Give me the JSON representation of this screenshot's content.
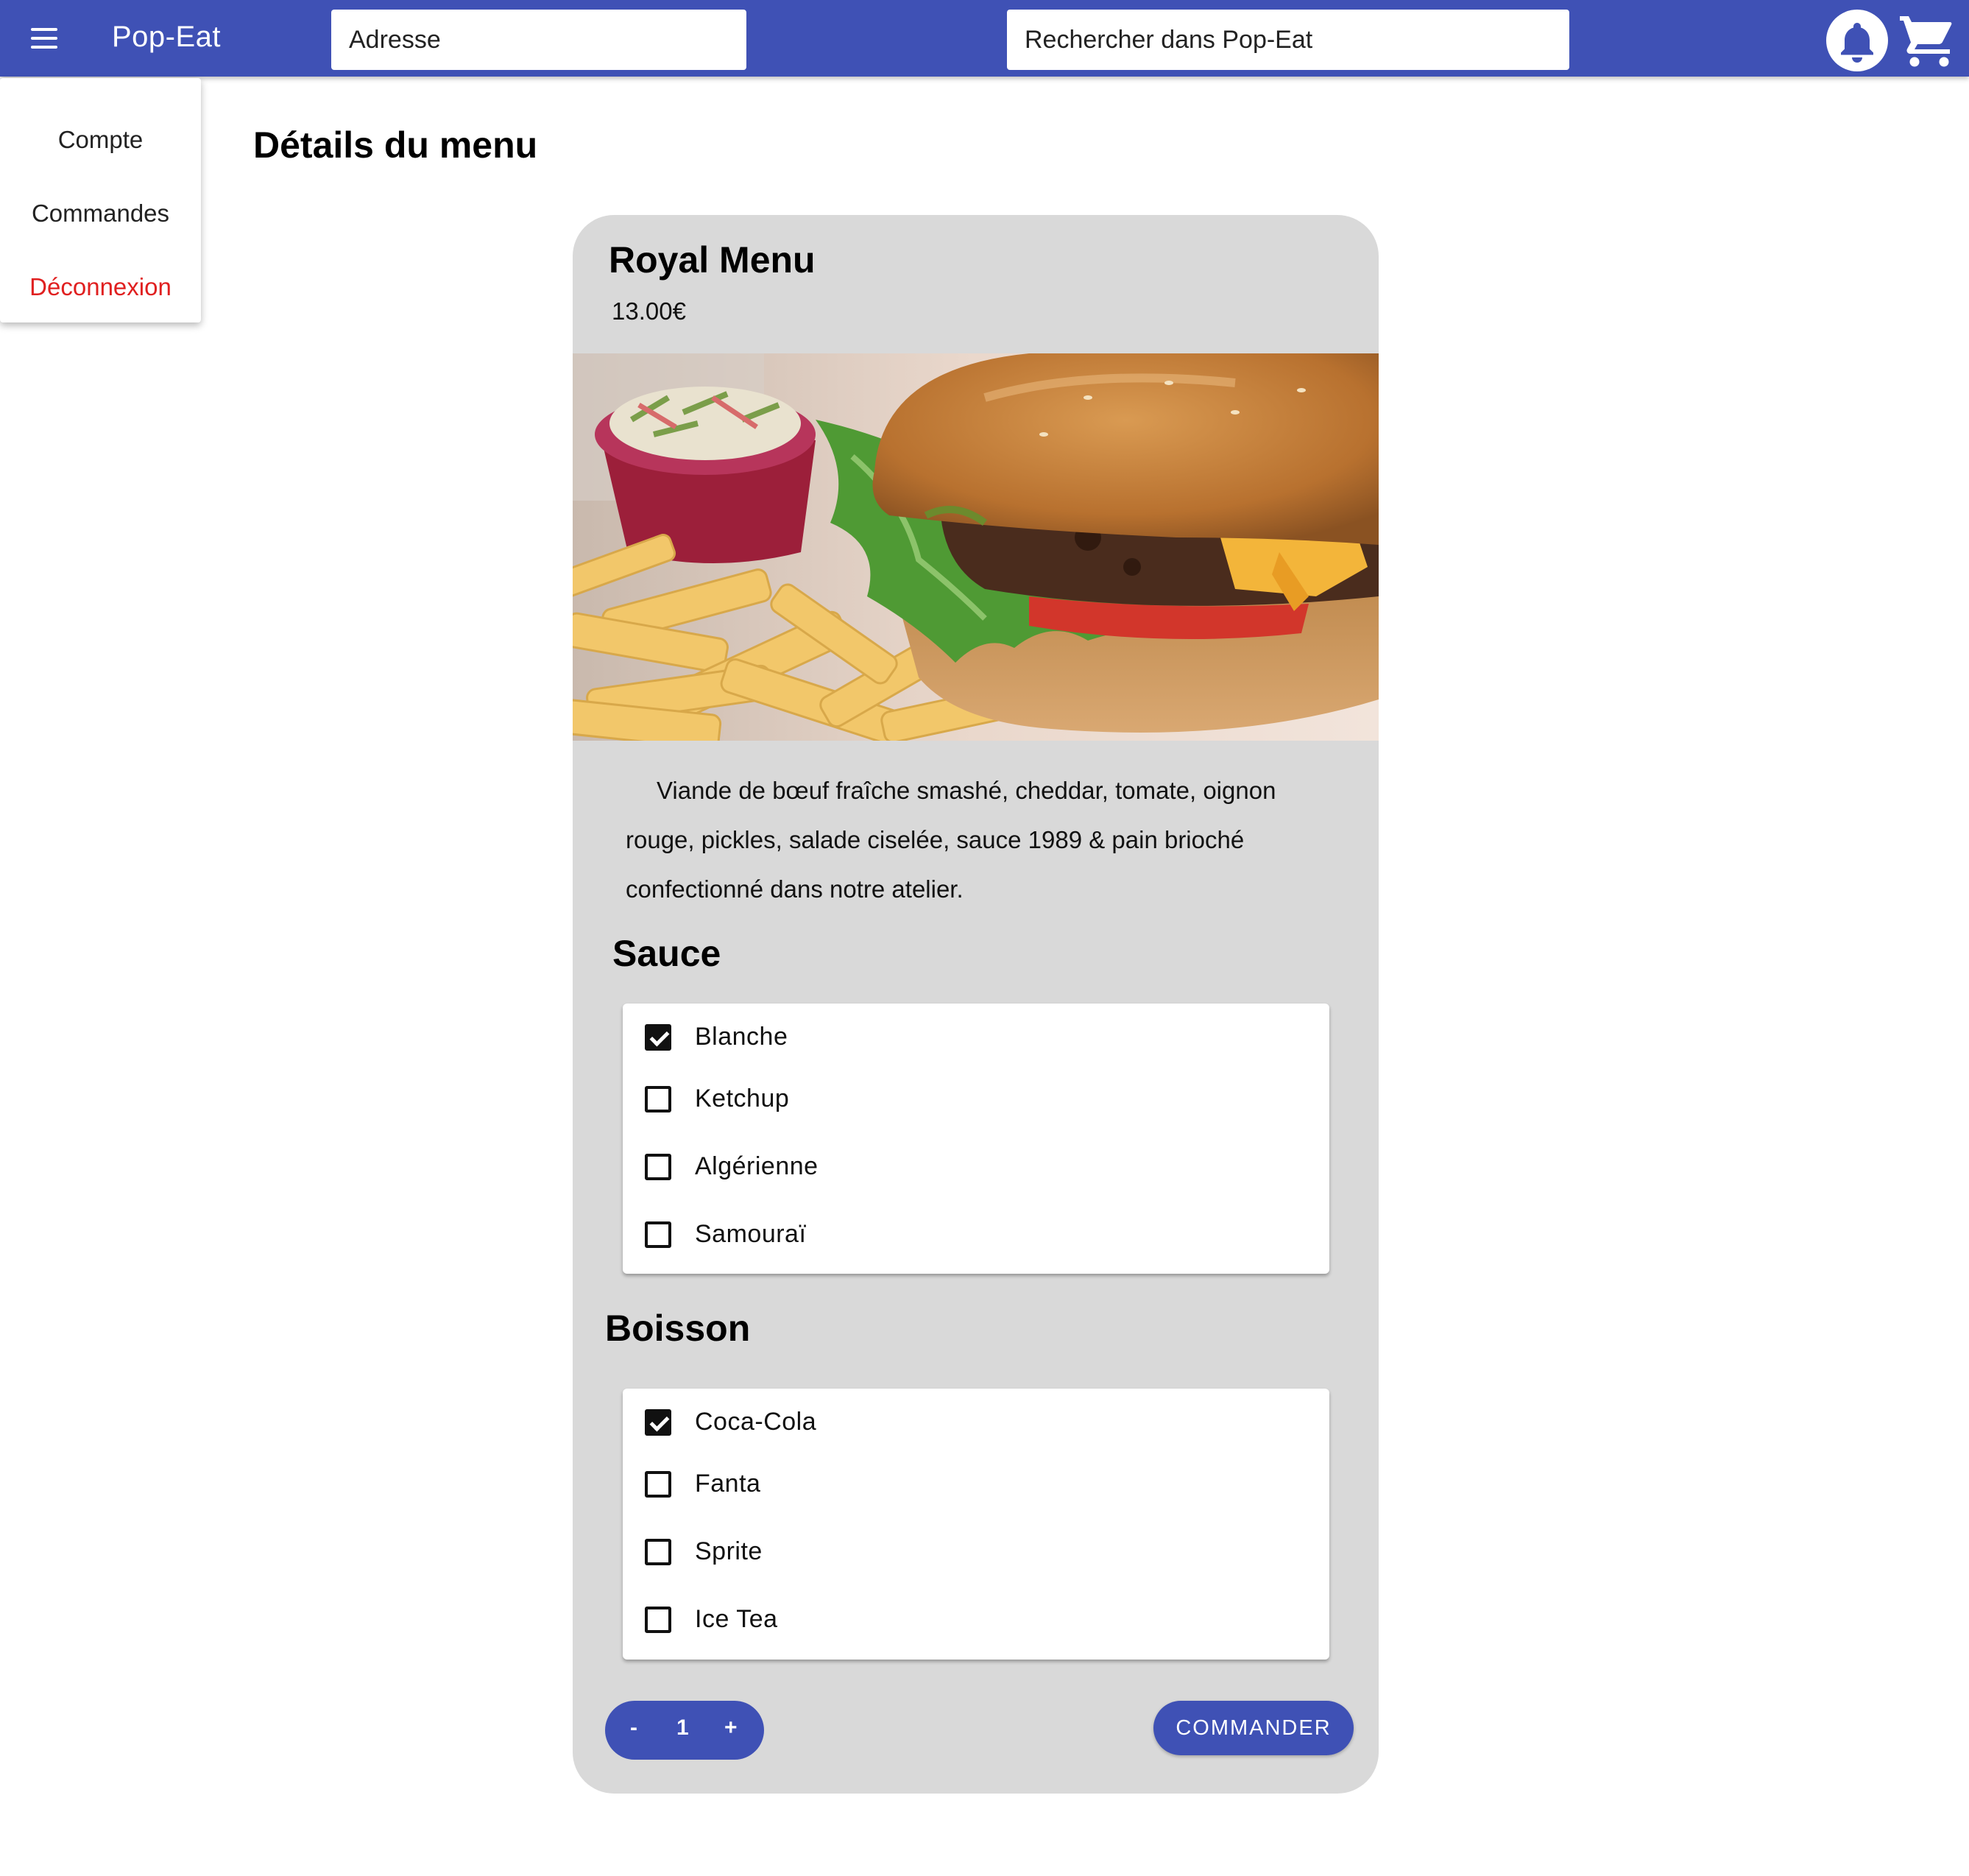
{
  "app": {
    "title": "Pop-Eat"
  },
  "header": {
    "address_placeholder": "Adresse",
    "search_placeholder": "Rechercher dans Pop-Eat"
  },
  "account_menu": {
    "items": [
      "Compte",
      "Commandes",
      "Déconnexion"
    ]
  },
  "page": {
    "title": "Détails du menu"
  },
  "menu": {
    "name": "Royal Menu",
    "price": "13.00€",
    "description": "Viande de bœuf fraîche smashé, cheddar, tomate, oignon rouge, pickles, salade ciselée, sauce 1989 & pain brioché confectionné dans notre atelier."
  },
  "sauce": {
    "title": "Sauce",
    "options": [
      {
        "label": "Blanche",
        "checked": true
      },
      {
        "label": "Ketchup",
        "checked": false
      },
      {
        "label": "Algérienne",
        "checked": false
      },
      {
        "label": "Samouraï",
        "checked": false
      }
    ]
  },
  "drink": {
    "title": "Boisson",
    "options": [
      {
        "label": "Coca-Cola",
        "checked": true
      },
      {
        "label": "Fanta",
        "checked": false
      },
      {
        "label": "Sprite",
        "checked": false
      },
      {
        "label": "Ice Tea",
        "checked": false
      }
    ]
  },
  "quantity": {
    "minus": "-",
    "value": "1",
    "plus": "+"
  },
  "order_button": "COMMANDER",
  "colors": {
    "primary": "#3f51b5",
    "card": "#d9d9d9",
    "danger": "#e02020"
  },
  "icons": {
    "menu": "hamburger-menu-icon",
    "notifications": "bell-icon",
    "cart": "shopping-cart-icon"
  }
}
